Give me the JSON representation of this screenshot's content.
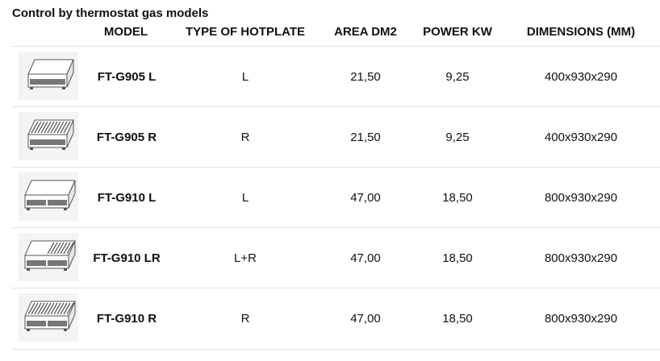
{
  "title": "Control by thermostat gas models",
  "headers": {
    "model": "MODEL",
    "hotplate": "TYPE OF HOTPLATE",
    "area": "AREA DM2",
    "power": "POWER KW",
    "dimensions": "DIMENSIONS (MM)"
  },
  "rows": [
    {
      "model": "FT-G905 L",
      "hotplate": "L",
      "area": "21,50",
      "power": "9,25",
      "dimensions": "400x930x290",
      "icon": "griddle-smooth-single-icon"
    },
    {
      "model": "FT-G905 R",
      "hotplate": "R",
      "area": "21,50",
      "power": "9,25",
      "dimensions": "400x930x290",
      "icon": "griddle-ribbed-single-icon"
    },
    {
      "model": "FT-G910 L",
      "hotplate": "L",
      "area": "47,00",
      "power": "18,50",
      "dimensions": "800x930x290",
      "icon": "griddle-smooth-double-icon"
    },
    {
      "model": "FT-G910 LR",
      "hotplate": "L+R",
      "area": "47,00",
      "power": "18,50",
      "dimensions": "800x930x290",
      "icon": "griddle-mixed-double-icon"
    },
    {
      "model": "FT-G910 R",
      "hotplate": "R",
      "area": "47,00",
      "power": "18,50",
      "dimensions": "800x930x290",
      "icon": "griddle-ribbed-double-icon"
    }
  ]
}
